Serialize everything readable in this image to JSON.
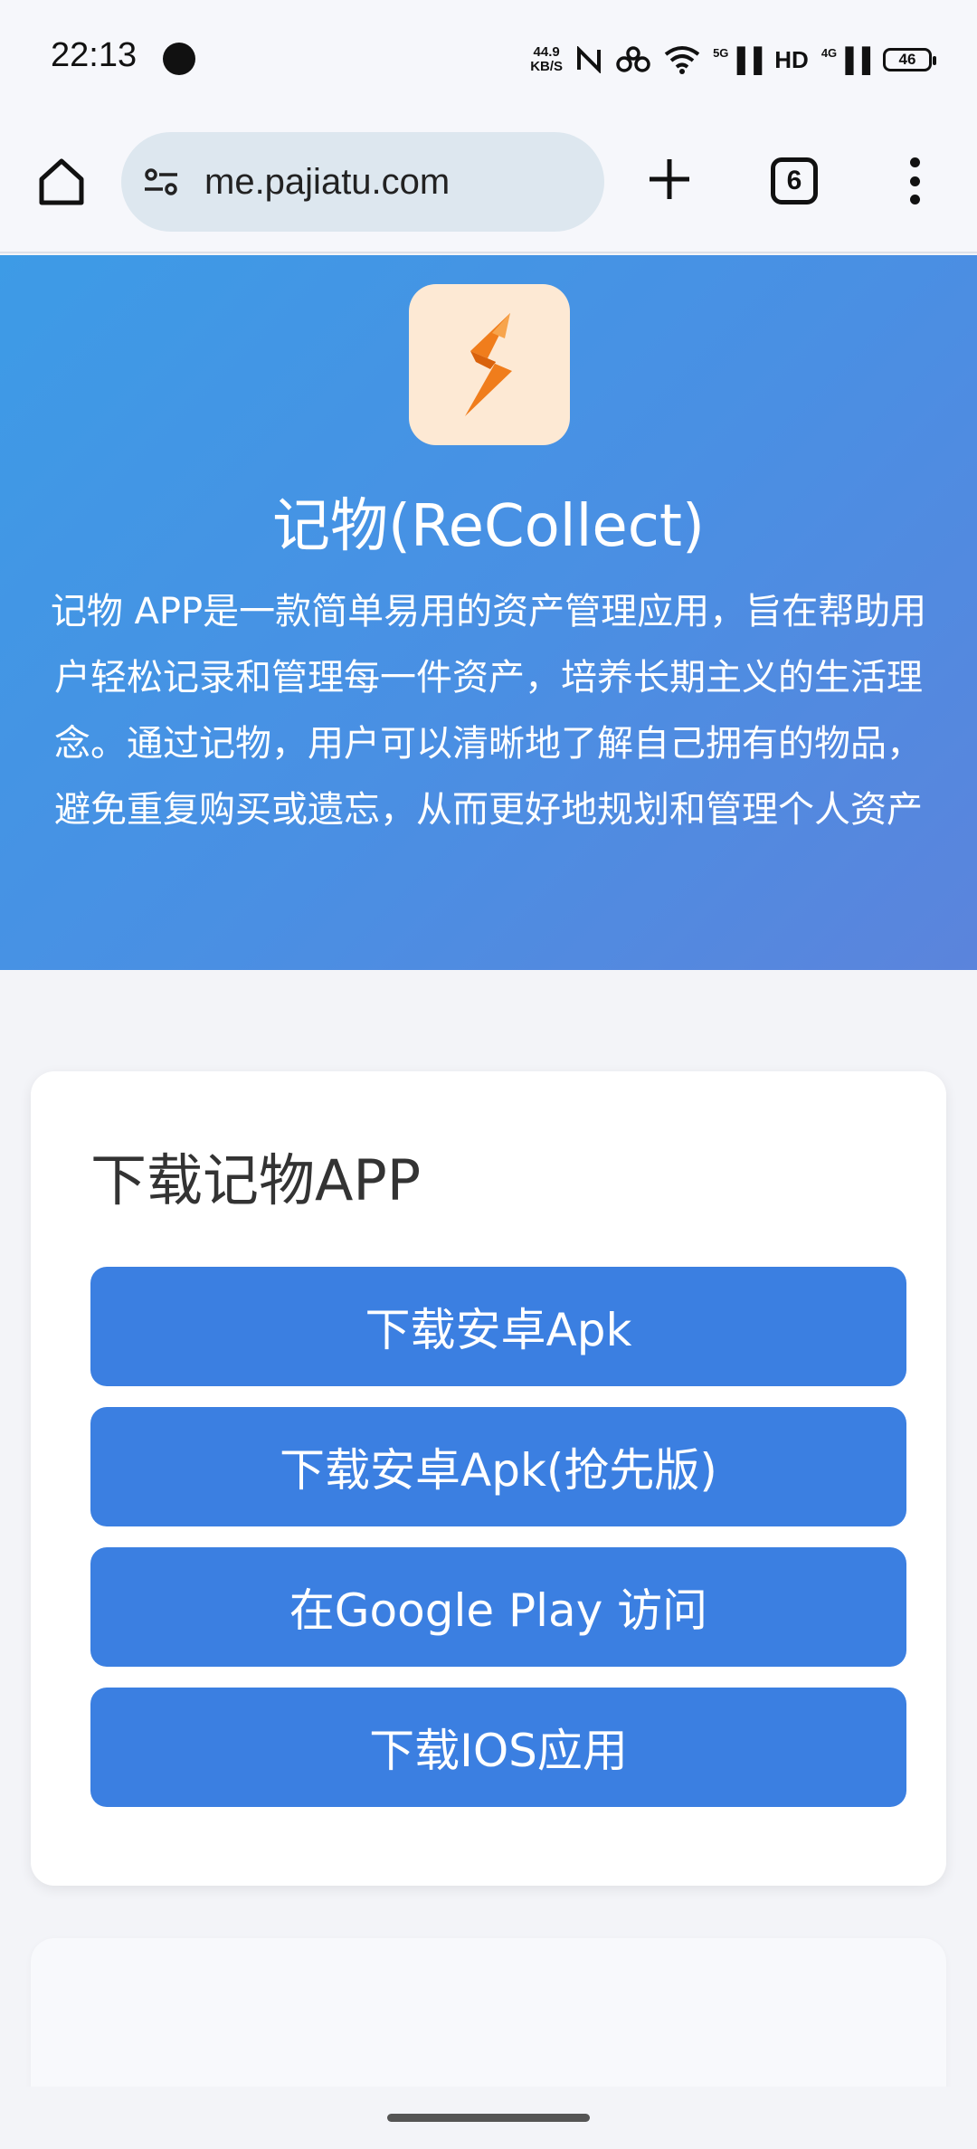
{
  "status_bar": {
    "time": "22:13",
    "net_speed_value": "44.9",
    "net_speed_unit": "KB/S",
    "signal_5g": "5G",
    "hd": "HD",
    "signal_4g": "4G",
    "battery": "46"
  },
  "browser": {
    "url": "me.pajiatu.com",
    "tab_count": "6"
  },
  "hero": {
    "title": "记物(ReCollect)",
    "description": "记物 APP是一款简单易用的资产管理应用，旨在帮助用户轻松记录和管理每一件资产，培养长期主义的生活理念。通过记物，用户可以清晰地了解自己拥有的物品，避免重复购买或遗忘，从而更好地规划和管理个人资产",
    "gradient_start": "#3d9be6",
    "gradient_end": "#5b84dc"
  },
  "download": {
    "title": "下载记物APP",
    "buttons": [
      {
        "label": "下载安卓Apk"
      },
      {
        "label": "下载安卓Apk(抢先版)"
      },
      {
        "label": "在Google Play 访问"
      },
      {
        "label": "下载IOS应用"
      }
    ],
    "button_color": "#3b7fe1"
  }
}
